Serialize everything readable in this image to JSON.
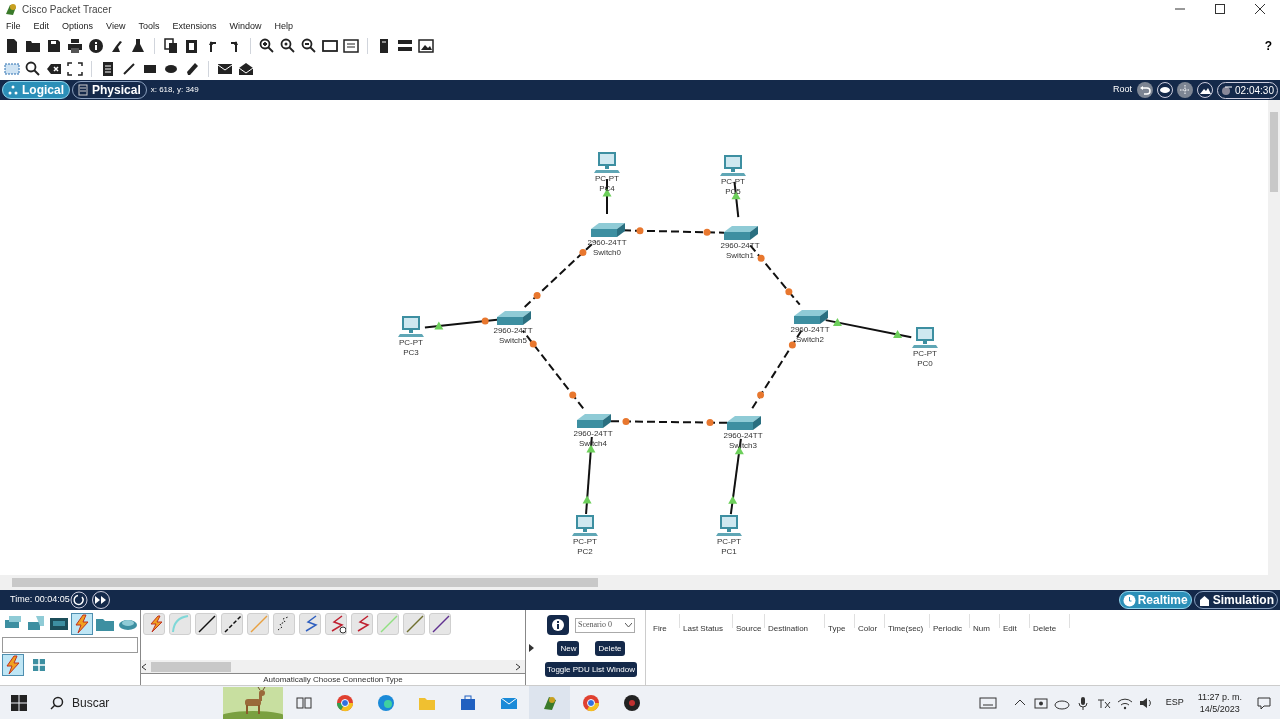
{
  "window": {
    "title": "Cisco Packet Tracer"
  },
  "menu": [
    "File",
    "Edit",
    "Options",
    "View",
    "Tools",
    "Extensions",
    "Window",
    "Help"
  ],
  "help_button": "?",
  "workspace_tabs": [
    {
      "label": "Logical",
      "selected": true
    },
    {
      "label": "Physical",
      "selected": false
    }
  ],
  "cursor_position": "x: 618, y: 349",
  "navigation": {
    "root": "Root",
    "clock": "02:04:30"
  },
  "topology": {
    "nodes": [
      {
        "kind": "pc",
        "model": "PC-PT",
        "name": "PC4"
      },
      {
        "kind": "pc",
        "model": "PC-PT",
        "name": "PC5"
      },
      {
        "kind": "switch",
        "model": "2960-24TT",
        "name": "Switch0"
      },
      {
        "kind": "switch",
        "model": "2960-24TT",
        "name": "Switch1"
      },
      {
        "kind": "pc",
        "model": "PC-PT",
        "name": "PC3"
      },
      {
        "kind": "switch",
        "model": "2960-24TT",
        "name": "Switch5"
      },
      {
        "kind": "switch",
        "model": "2960-24TT",
        "name": "Switch2"
      },
      {
        "kind": "pc",
        "model": "PC-PT",
        "name": "PC0"
      },
      {
        "kind": "switch",
        "model": "2960-24TT",
        "name": "Switch4"
      },
      {
        "kind": "switch",
        "model": "2960-24TT",
        "name": "Switch3"
      },
      {
        "kind": "pc",
        "model": "PC-PT",
        "name": "PC2"
      },
      {
        "kind": "pc",
        "model": "PC-PT",
        "name": "PC1"
      }
    ],
    "links": [
      {
        "kind": "straight",
        "end_b_light": {
          "color": "#6ccf5a"
        }
      },
      {
        "kind": "straight",
        "end_b_light": {
          "color": "#6ccf5a"
        }
      },
      {
        "kind": "crossover",
        "end_a_light": {
          "color": "#e8772e"
        },
        "end_b_light": {
          "color": "#e8772e"
        }
      },
      {
        "kind": "crossover",
        "end_a_light": {
          "color": "#e8772e"
        },
        "end_b_light": {
          "color": "#e8772e"
        }
      },
      {
        "kind": "crossover",
        "end_a_light": {
          "color": "#e8772e"
        },
        "end_b_light": {
          "color": "#e8772e"
        }
      },
      {
        "kind": "straight",
        "end_a_light": {
          "color": "#e8772e"
        },
        "end_b_light": {
          "color": "#6ccf5a"
        }
      },
      {
        "kind": "straight",
        "end_a_light": {
          "color": "#6ccf5a"
        },
        "end_b_light": {
          "color": "#6ccf5a"
        }
      },
      {
        "kind": "crossover",
        "end_a_light": {
          "color": "#e8772e"
        },
        "end_b_light": {
          "color": "#e8772e"
        }
      },
      {
        "kind": "crossover",
        "end_a_light": {
          "color": "#e8772e"
        },
        "end_b_light": {
          "color": "#e8772e"
        }
      },
      {
        "kind": "crossover",
        "end_a_light": {
          "color": "#e8772e"
        },
        "end_b_light": {
          "color": "#e8772e"
        }
      },
      {
        "kind": "straight",
        "end_a_light": {
          "color": "#6ccf5a"
        },
        "end_b_light": {
          "color": "#6ccf5a"
        }
      },
      {
        "kind": "straight",
        "end_a_light": {
          "color": "#6ccf5a"
        },
        "end_b_light": {
          "color": "#6ccf5a"
        }
      }
    ]
  },
  "simulation_bar": {
    "time": "Time: 00:04:05",
    "modes": [
      {
        "label": "Realtime",
        "selected": true
      },
      {
        "label": "Simulation",
        "selected": false
      }
    ]
  },
  "device_categories": [
    {
      "selected": false
    },
    {
      "selected": false
    },
    {
      "selected": false
    },
    {
      "selected": true
    },
    {
      "selected": false
    },
    {
      "selected": false
    }
  ],
  "subcategories": [
    {
      "selected": true
    },
    {
      "selected": false
    }
  ],
  "connection_caption": "Automatically Choose Connection Type",
  "pdu_panel": {
    "scenario": "Scenario 0",
    "buttons": [
      "New",
      "Delete"
    ],
    "toggle_button": "Toggle PDU List Window",
    "columns": [
      "Fire",
      "Last Status",
      "Source",
      "Destination",
      "Type",
      "Color",
      "Time(sec)",
      "Periodic",
      "Num",
      "Edit",
      "Delete"
    ]
  },
  "taskbar": {
    "search": {
      "placeholder": "Buscar"
    },
    "language": "ESP",
    "time": "11:27 p. m.",
    "date": "14/5/2023"
  }
}
